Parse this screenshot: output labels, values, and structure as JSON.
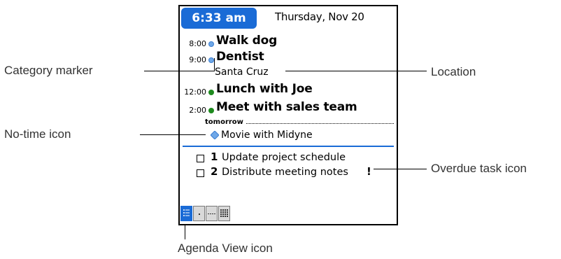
{
  "screen": {
    "time": "6:33 am",
    "date": "Thursday, Nov 20"
  },
  "events": [
    {
      "time": "8:00",
      "title": "Walk dog",
      "marker": "blue"
    },
    {
      "time": "9:00",
      "title": "Dentist",
      "marker": "blue",
      "location": "Santa Cruz"
    },
    {
      "time": "12:00",
      "title": "Lunch with Joe",
      "marker": "green"
    },
    {
      "time": "2:00",
      "title": "Meet with sales team",
      "marker": "green"
    }
  ],
  "tomorrow": {
    "label": "tomorrow",
    "item": "Movie with Midyne"
  },
  "tasks": [
    {
      "priority": "1",
      "text": "Update project schedule",
      "overdue": false
    },
    {
      "priority": "2",
      "text": "Distribute meeting notes",
      "overdue": true,
      "overdue_mark": "!"
    }
  ],
  "callouts": {
    "category_marker": "Category marker",
    "location": "Location",
    "no_time_icon": "No-time icon",
    "overdue_task_icon": "Overdue task icon",
    "agenda_view_icon": "Agenda View icon"
  },
  "view_buttons": [
    "agenda-view-icon",
    "day-view-icon",
    "week-view-icon",
    "month-view-icon"
  ],
  "colors": {
    "accent": "#1a6bd6",
    "marker_blue": "#6fa8e8",
    "marker_green": "#1e8a1e"
  }
}
